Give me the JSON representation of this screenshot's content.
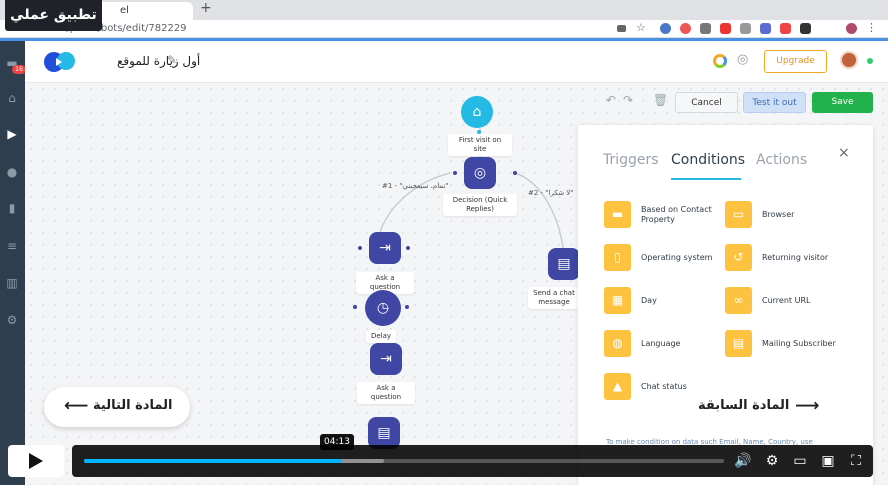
{
  "lesson_badge": "تطبيق عملي",
  "browser": {
    "tab_title": "el",
    "new_tab": "+",
    "url": "com/panel/bots/edit/782229"
  },
  "sidebar": {
    "notification_count": "16"
  },
  "header": {
    "bot_name": "أول زيارة للموقع",
    "upgrade_label": "Upgrade"
  },
  "toolbar": {
    "cancel_label": "Cancel",
    "test_label": "Test it out",
    "save_label": "Save"
  },
  "flow": {
    "nodes": [
      {
        "label": "First visit on site",
        "icon": "home-icon"
      },
      {
        "label": "Decision (Quick Replies)",
        "icon": "decision-icon"
      },
      {
        "label": "Ask a question",
        "icon": "question-icon"
      },
      {
        "label": "Delay",
        "icon": "clock-icon"
      },
      {
        "label": "Ask a question",
        "icon": "question-icon"
      },
      {
        "label": "Send a chat message",
        "icon": "message-icon"
      }
    ],
    "edge_1": "#1 - \"تمام، سيعجبني\"",
    "edge_2": "#2 - \"لا شكرا\""
  },
  "panel": {
    "tabs": [
      "Triggers",
      "Conditions",
      "Actions"
    ],
    "active_tab": "Conditions",
    "close": "×",
    "conditions": [
      {
        "label": "Based on Contact Property",
        "icon": "folder-icon"
      },
      {
        "label": "Browser",
        "icon": "browser-icon"
      },
      {
        "label": "Operating system",
        "icon": "os-icon"
      },
      {
        "label": "Returning visitor",
        "icon": "return-icon"
      },
      {
        "label": "Day",
        "icon": "calendar-icon"
      },
      {
        "label": "Current URL",
        "icon": "link-icon"
      },
      {
        "label": "Language",
        "icon": "globe-icon"
      },
      {
        "label": "Mailing Subscriber",
        "icon": "card-icon"
      },
      {
        "label": "Chat status",
        "icon": "bell-icon"
      }
    ],
    "footnote": "To make condition on data such Email, Name, Country, use"
  },
  "nav": {
    "next_label": "المادة التالية",
    "prev_label": "المادة السابقة"
  },
  "video": {
    "time_tooltip": "04:13",
    "progress_fraction": 0.403,
    "accent": "#00b3ff"
  },
  "colors": {
    "node": "#3f46a3",
    "home_node": "#25b9e6",
    "condition_tile": "#fdc240",
    "save": "#22b24c",
    "upgrade": "#f5a623"
  }
}
